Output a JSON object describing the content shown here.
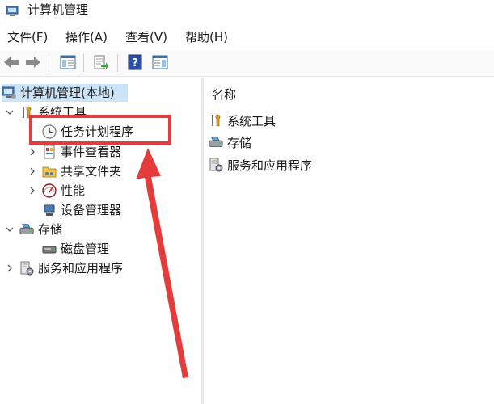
{
  "window": {
    "title": "计算机管理"
  },
  "menu": {
    "items": [
      "文件(F)",
      "操作(A)",
      "查看(V)",
      "帮助(H)"
    ]
  },
  "tree": {
    "root": "计算机管理(本地)",
    "system_tools": "系统工具",
    "task_scheduler": "任务计划程序",
    "event_viewer": "事件查看器",
    "shared_folders": "共享文件夹",
    "performance": "性能",
    "device_manager": "设备管理器",
    "storage": "存储",
    "disk_management": "磁盘管理",
    "services_apps": "服务和应用程序"
  },
  "list": {
    "column_name": "名称",
    "items": [
      "系统工具",
      "存储",
      "服务和应用程序"
    ]
  },
  "annotation": {
    "color": "#e43b3b"
  },
  "colors": {
    "selection": "#cce4f7"
  }
}
